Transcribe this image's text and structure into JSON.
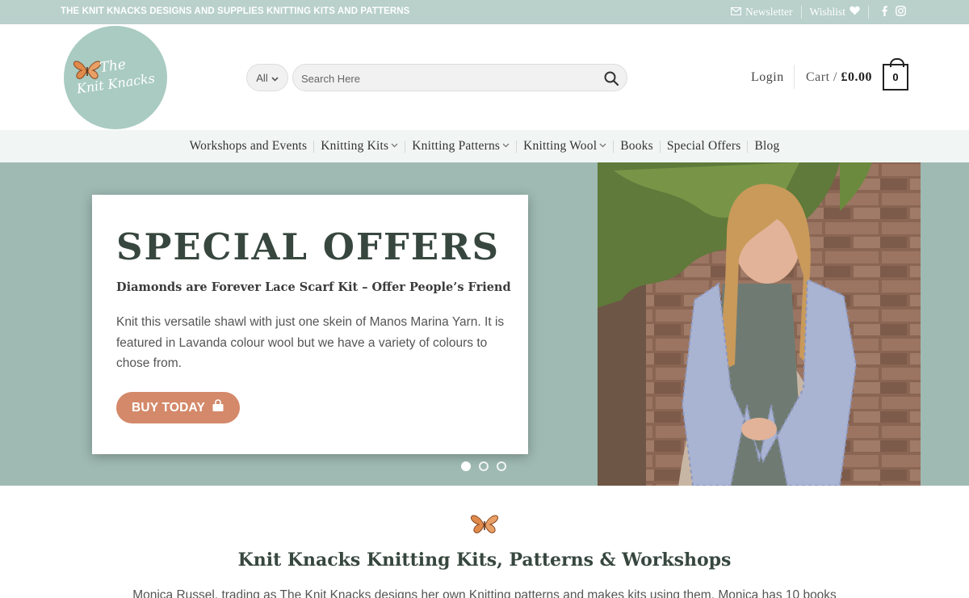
{
  "topbar": {
    "tagline": "THE KNIT KNACKS DESIGNS AND SUPPLIES KNITTING KITS AND PATTERNS",
    "newsletter": "Newsletter",
    "wishlist": "Wishlist",
    "social": [
      "facebook-icon",
      "instagram-icon"
    ]
  },
  "header": {
    "logo": {
      "line1": "The",
      "line2": "Knit Knacks"
    },
    "category": "All",
    "search_placeholder": "Search Here",
    "login": "Login",
    "cart_label": "Cart /",
    "cart_total": "£0.00",
    "cart_count": "0"
  },
  "nav": {
    "items": [
      {
        "label": "Workshops and Events",
        "dropdown": false
      },
      {
        "label": "Knitting Kits",
        "dropdown": true
      },
      {
        "label": "Knitting Patterns",
        "dropdown": true
      },
      {
        "label": "Knitting Wool",
        "dropdown": true
      },
      {
        "label": "Books",
        "dropdown": false
      },
      {
        "label": "Special Offers",
        "dropdown": false
      },
      {
        "label": "Blog",
        "dropdown": false
      }
    ]
  },
  "hero": {
    "title": "SPECIAL OFFERS",
    "subtitle": "Diamonds are Forever Lace Scarf Kit – Offer People’s Friend",
    "body": "Knit this versatile shawl with just one skein of Manos Marina Yarn. It is featured in Lavanda colour wool but we have a variety of colours to chose from.",
    "button": "BUY TODAY",
    "slides": 3,
    "active_slide": 1
  },
  "intro": {
    "title": "Knit Knacks Knitting Kits, Patterns & Workshops",
    "text": "Monica Russel, trading as The Knit Knacks designs her own Knitting patterns and makes kits using them. Monica has 10 books"
  },
  "colors": {
    "topbar": "#b9d0cb",
    "hero_bg": "#9fbab3",
    "heading": "#37473f",
    "button": "#d4896a",
    "nav_bg": "#f1f6f4"
  }
}
